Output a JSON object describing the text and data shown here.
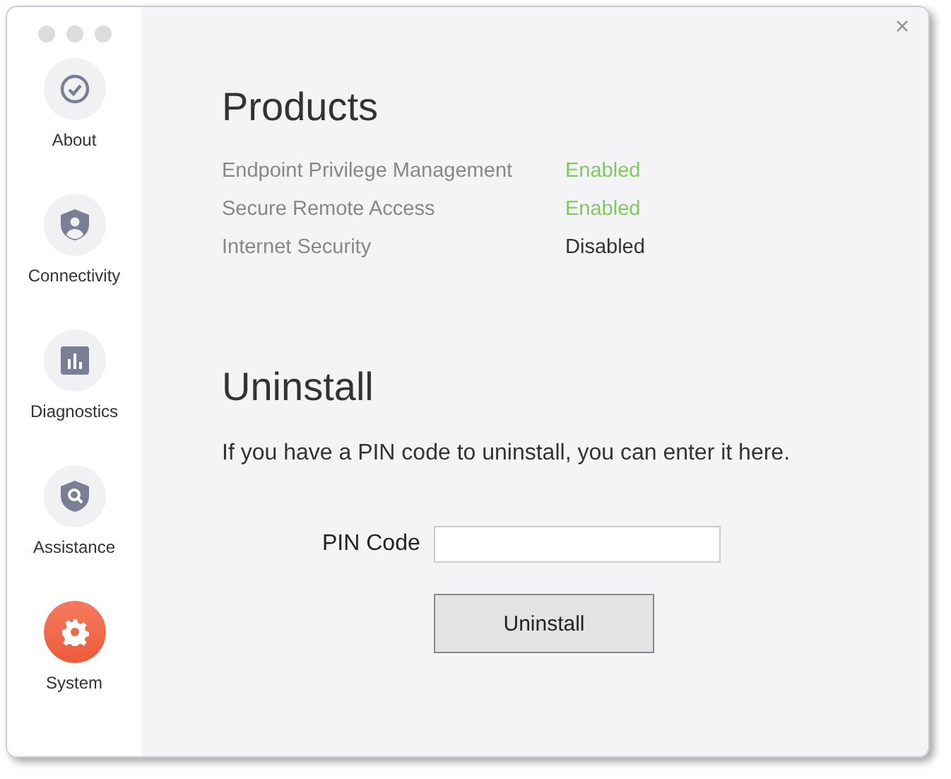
{
  "sidebar": {
    "items": [
      {
        "label": "About",
        "selected": false
      },
      {
        "label": "Connectivity",
        "selected": false
      },
      {
        "label": "Diagnostics",
        "selected": false
      },
      {
        "label": "Assistance",
        "selected": false
      },
      {
        "label": "System",
        "selected": true
      }
    ]
  },
  "products": {
    "title": "Products",
    "rows": [
      {
        "name": "Endpoint Privilege Management",
        "status": "Enabled",
        "enabled": true
      },
      {
        "name": "Secure Remote Access",
        "status": "Enabled",
        "enabled": true
      },
      {
        "name": "Internet Security",
        "status": "Disabled",
        "enabled": false
      }
    ]
  },
  "uninstall": {
    "title": "Uninstall",
    "description": "If you have a PIN code to uninstall, you can enter it here.",
    "pin_label": "PIN Code",
    "button": "Uninstall"
  }
}
